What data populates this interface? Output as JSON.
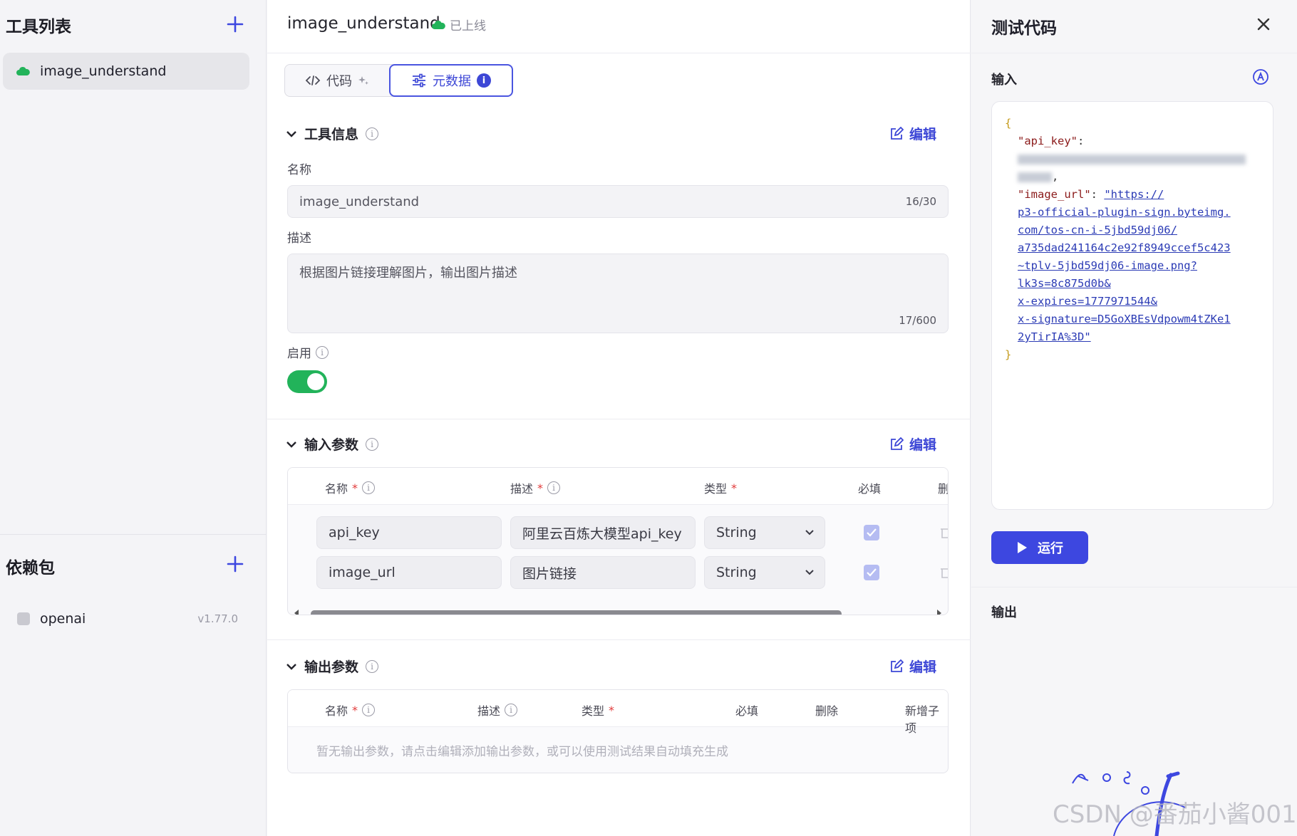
{
  "sidebar": {
    "tools_title": "工具列表",
    "tools": [
      {
        "label": "image_understand"
      }
    ],
    "deps_title": "依赖包",
    "deps": [
      {
        "name": "openai",
        "version": "v1.77.0"
      }
    ]
  },
  "header": {
    "title": "image_understand",
    "status": "已上线"
  },
  "tabs": [
    {
      "label": "代码"
    },
    {
      "label": "元数据"
    }
  ],
  "tool_info": {
    "title": "工具信息",
    "edit_label": "编辑",
    "name_label": "名称",
    "name_value": "image_understand",
    "name_count": "16/30",
    "desc_label": "描述",
    "desc_value": "根据图片链接理解图片，输出图片描述",
    "desc_count": "17/600",
    "enable_label": "启用",
    "enabled": true
  },
  "input_params": {
    "title": "输入参数",
    "edit_label": "编辑",
    "columns": [
      "名称",
      "描述",
      "类型",
      "必填",
      "删"
    ],
    "rows": [
      {
        "name": "api_key",
        "desc": "阿里云百炼大模型api_key",
        "type": "String",
        "required": true
      },
      {
        "name": "image_url",
        "desc": "图片链接",
        "type": "String",
        "required": true
      }
    ]
  },
  "output_params": {
    "title": "输出参数",
    "edit_label": "编辑",
    "columns": [
      "名称",
      "描述",
      "类型",
      "必填",
      "删除",
      "新增子项"
    ],
    "empty_text": "暂无输出参数，请点击编辑添加输出参数，或可以使用测试结果自动填充生成"
  },
  "test_panel": {
    "title": "测试代码",
    "input_label": "输入",
    "code": {
      "open_brace": "{",
      "key1": "\"api_key\"",
      "colon": ":",
      "comma": ",",
      "key2": "\"image_url\"",
      "url_lines": [
        "\"https://",
        "p3-official-plugin-sign.byteimg.",
        "com/tos-cn-i-5jbd59dj06/",
        "a735dad241164c2e92f8949ccef5c423",
        "~tplv-5jbd59dj06-image.png?",
        "lk3s=8c875d0b&",
        "x-expires=1777971544&",
        "x-signature=D5GoXBEsVdpowm4tZKe1",
        "2yTirIA%3D\""
      ],
      "close_brace": "}"
    },
    "run_label": "运行",
    "output_label": "输出"
  },
  "watermark": "CSDN @番茄小酱001",
  "colors": {
    "accent": "#3d47e0",
    "toggle_on": "#22b35a",
    "online": "#22b35a"
  }
}
